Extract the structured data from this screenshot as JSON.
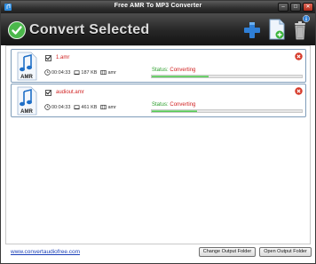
{
  "window": {
    "title": "Free AMR To MP3 Converter"
  },
  "header": {
    "convert_label": "Convert Selected",
    "tools": {
      "add": "add-icon",
      "output": "file-icon",
      "delete": "trash-icon",
      "info": "info-icon"
    }
  },
  "items": [
    {
      "filename": "1.amr",
      "duration": "00:04:33",
      "size": "187 KB",
      "format": "amr",
      "status_label": "Status:",
      "status_value": "Converting",
      "progress": 0.38
    },
    {
      "filename": "audiout.amr",
      "duration": "00:04:33",
      "size": "461 KB",
      "format": "amr",
      "status_label": "Status:",
      "status_value": "Converting",
      "progress": 0.3
    }
  ],
  "file_icon_label": "AMR",
  "footer": {
    "link": "www.convertaudiofree.com",
    "change_folder": "Change Output Folder",
    "open_folder": "Open Output Folder"
  },
  "colors": {
    "accent_green": "#3fbf3f",
    "status_red": "#d02020",
    "link_blue": "#1a3fb8"
  }
}
